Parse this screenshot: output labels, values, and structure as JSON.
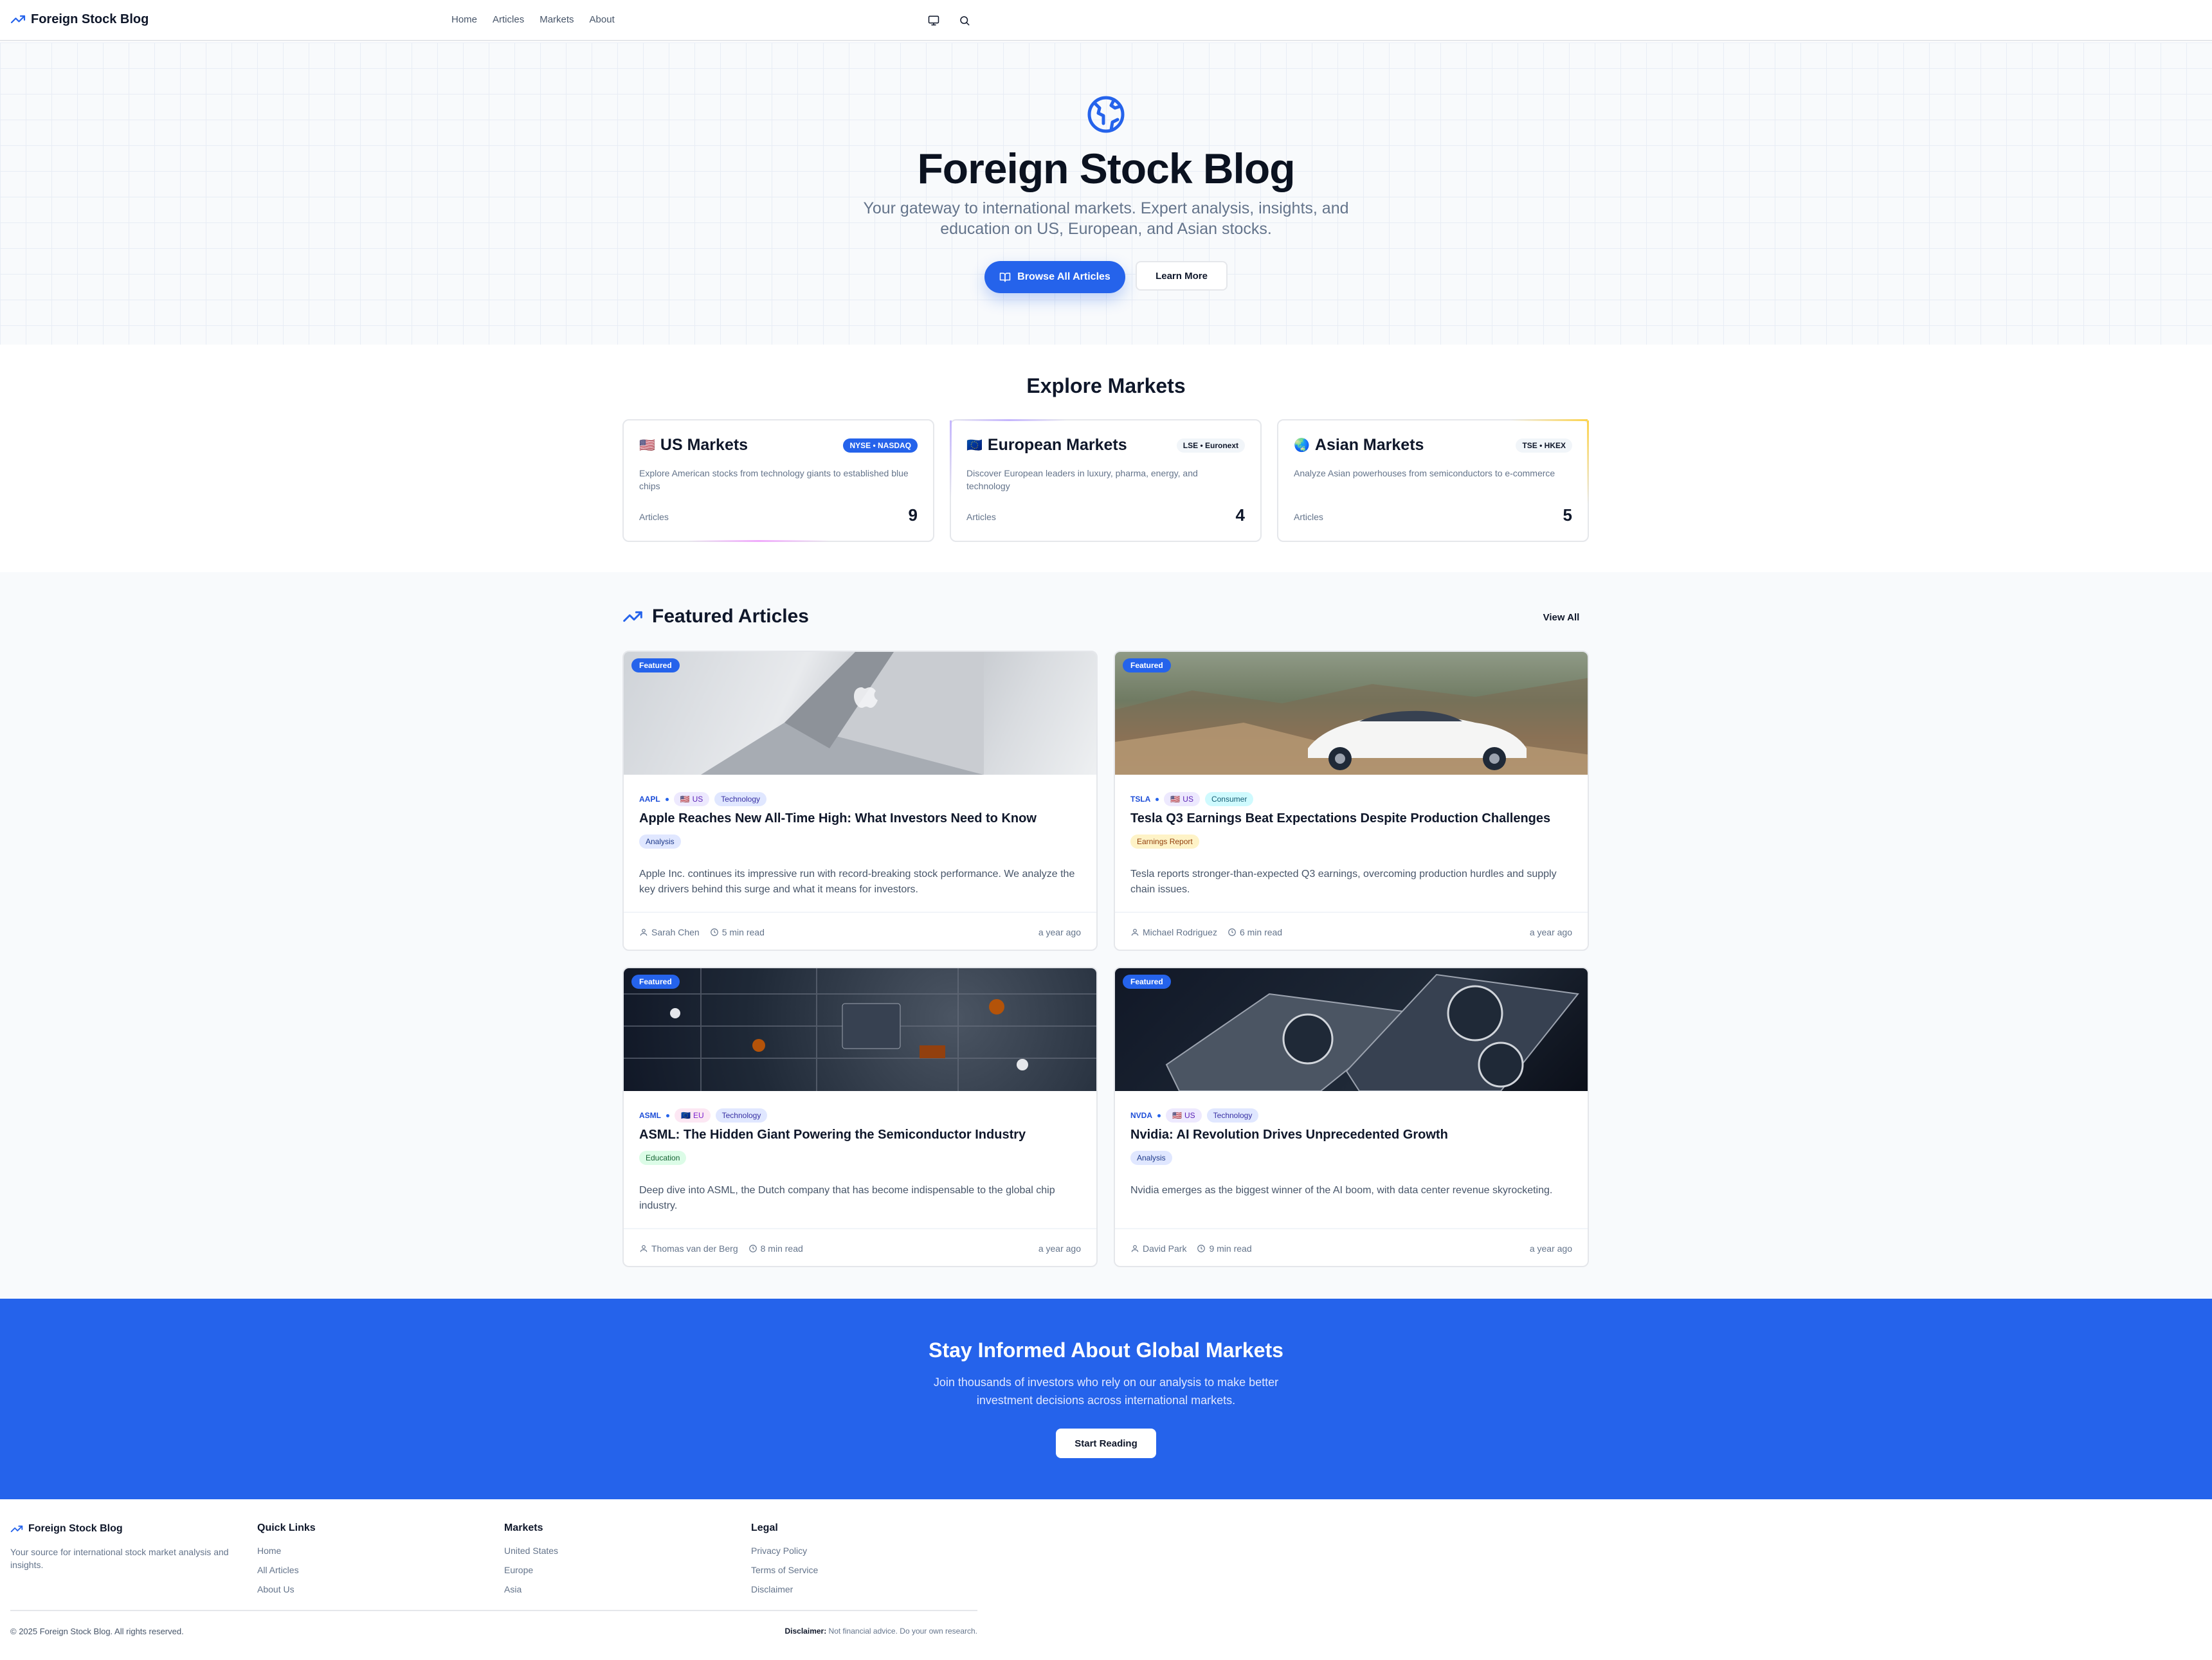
{
  "header": {
    "brand": "Foreign Stock Blog",
    "nav": [
      "Home",
      "Articles",
      "Markets",
      "About"
    ]
  },
  "hero": {
    "title": "Foreign Stock Blog",
    "subtitle": "Your gateway to international markets. Expert analysis, insights, and education on US, European, and Asian stocks.",
    "primary_button": "Browse All Articles",
    "secondary_button": "Learn More"
  },
  "markets": {
    "title": "Explore Markets",
    "cards": [
      {
        "flag": "🇺🇸",
        "name": "US Markets",
        "badge": "NYSE • NASDAQ",
        "description": "Explore American stocks from technology giants to established blue chips",
        "label": "Articles",
        "count": "9"
      },
      {
        "flag": "🇪🇺",
        "name": "European Markets",
        "badge": "LSE • Euronext",
        "description": "Discover European leaders in luxury, pharma, energy, and technology",
        "label": "Articles",
        "count": "4"
      },
      {
        "flag": "🌏",
        "name": "Asian Markets",
        "badge": "TSE • HKEX",
        "description": "Analyze Asian powerhouses from semiconductors to e-commerce",
        "label": "Articles",
        "count": "5"
      }
    ]
  },
  "featured": {
    "title": "Featured Articles",
    "view_all": "View All",
    "badge": "Featured",
    "articles": [
      {
        "ticker": "AAPL",
        "region": "US",
        "region_flag": "🇺🇸",
        "sector": "Technology",
        "title": "Apple Reaches New All-Time High: What Investors Need to Know",
        "category": "Analysis",
        "excerpt": "Apple Inc. continues its impressive run with record-breaking stock performance. We analyze the key drivers behind this surge and what it means for investors.",
        "author": "Sarah Chen",
        "read": "5 min read",
        "ago": "a year ago"
      },
      {
        "ticker": "TSLA",
        "region": "US",
        "region_flag": "🇺🇸",
        "sector": "Consumer",
        "title": "Tesla Q3 Earnings Beat Expectations Despite Production Challenges",
        "category": "Earnings Report",
        "excerpt": "Tesla reports stronger-than-expected Q3 earnings, overcoming production hurdles and supply chain issues.",
        "author": "Michael Rodriguez",
        "read": "6 min read",
        "ago": "a year ago"
      },
      {
        "ticker": "ASML",
        "region": "EU",
        "region_flag": "🇪🇺",
        "sector": "Technology",
        "title": "ASML: The Hidden Giant Powering the Semiconductor Industry",
        "category": "Education",
        "excerpt": "Deep dive into ASML, the Dutch company that has become indispensable to the global chip industry.",
        "author": "Thomas van der Berg",
        "read": "8 min read",
        "ago": "a year ago"
      },
      {
        "ticker": "NVDA",
        "region": "US",
        "region_flag": "🇺🇸",
        "sector": "Technology",
        "title": "Nvidia: AI Revolution Drives Unprecedented Growth",
        "category": "Analysis",
        "excerpt": "Nvidia emerges as the biggest winner of the AI boom, with data center revenue skyrocketing.",
        "author": "David Park",
        "read": "9 min read",
        "ago": "a year ago"
      }
    ]
  },
  "cta": {
    "title": "Stay Informed About Global Markets",
    "subtitle": "Join thousands of investors who rely on our analysis to make better investment decisions across international markets.",
    "button": "Start Reading"
  },
  "footer": {
    "brand": "Foreign Stock Blog",
    "description": "Your source for international stock market analysis and insights.",
    "columns": [
      {
        "title": "Quick Links",
        "links": [
          "Home",
          "All Articles",
          "About Us"
        ]
      },
      {
        "title": "Markets",
        "links": [
          "United States",
          "Europe",
          "Asia"
        ]
      },
      {
        "title": "Legal",
        "links": [
          "Privacy Policy",
          "Terms of Service",
          "Disclaimer"
        ]
      }
    ],
    "copyright": "© 2025 Foreign Stock Blog. All rights reserved.",
    "disclaimer_label": "Disclaimer:",
    "disclaimer_text": "Not financial advice. Do your own research."
  },
  "colors": {
    "accent": "#2563eb",
    "text": "#0f172a",
    "muted": "#64748b"
  }
}
